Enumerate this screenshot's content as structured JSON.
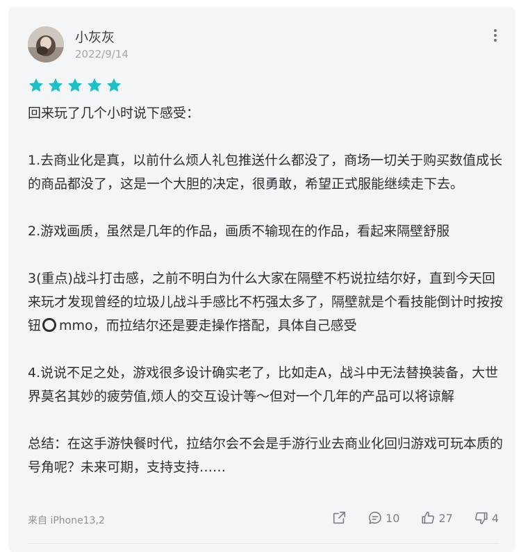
{
  "review": {
    "user": {
      "name": "小灰灰",
      "date": "2022/9/14"
    },
    "rating": 5,
    "rating_color": "#1cc1c8",
    "paragraphs": [
      "回来玩了几个小时说下感受：",
      "1.去商业化是真，以前什么烦人礼包推送什么都没了，商场一切关于购买数值成长的商品都没了，这是一个大胆的决定，很勇敢，希望正式服能继续走下去。",
      "2.游戏画质，虽然是几年的作品，画质不输现在的作品，看起来隔壁舒服",
      "3(重点)战斗打击感，之前不明白为什么大家在隔壁不朽说拉结尔好，直到今天回来玩才发现曾经的垃圾儿战斗手感比不朽强太多了，隔壁就是个看技能倒计时按按钮",
      "mmo，而拉结尔还是要走操作搭配，具体自己感受",
      "4.说说不足之处，游戏很多设计确实老了，比如走A，战斗中无法替换装备，大世界莫名其妙的疲劳值,烦人的交互设计等～但对一个几年的产品可以将谅解",
      "总结：在这手游快餐时代，拉结尔会不会是手游行业去商业化回归游戏可玩本质的号角呢？未来可期，支持支持……"
    ],
    "source": "来自 iPhone13,2",
    "actions": {
      "reply_count": "10",
      "like_count": "27",
      "dislike_count": "4"
    }
  }
}
